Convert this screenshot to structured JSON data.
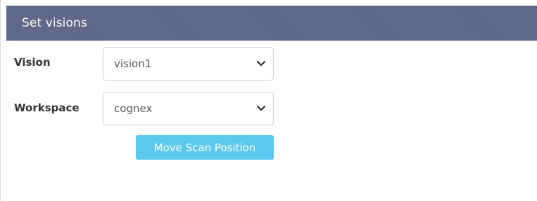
{
  "panel": {
    "title": "Set visions"
  },
  "form": {
    "vision": {
      "label": "Vision",
      "selected": "vision1"
    },
    "workspace": {
      "label": "Workspace",
      "selected": "cognex"
    },
    "move_button_label": "Move Scan Position"
  },
  "icons": {
    "dropdown": "chevron-down-icon"
  },
  "colors": {
    "header_bg": "#5d6688",
    "button_bg": "#5bc9ee",
    "text": "#333333"
  }
}
